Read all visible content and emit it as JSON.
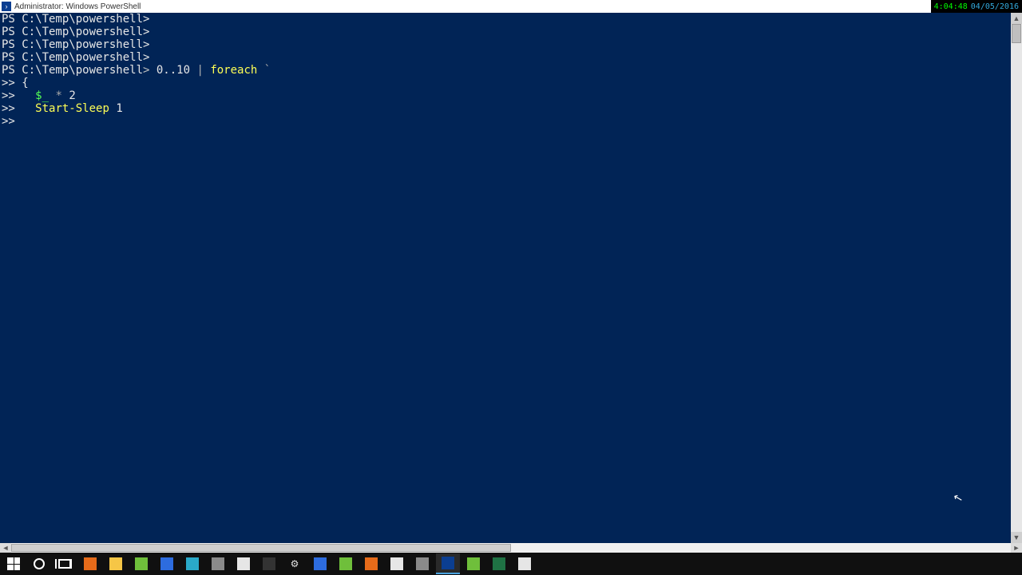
{
  "titlebar": {
    "title": "Administrator: Windows PowerShell"
  },
  "clock": {
    "time": "4:04:48",
    "date": "04/05/2016"
  },
  "console": {
    "prompt_prefix": "PS ",
    "path": "C:\\Temp\\powershell",
    "prompt_suffix": ">",
    "empty_lines": 4,
    "command_line": {
      "caret": ">",
      "range": "0..10",
      "pipe": "|",
      "keyword": "foreach",
      "backtick": "`"
    },
    "continuation": ">>",
    "cont_lines": {
      "l1": "{",
      "l2_var": "$_",
      "l2_op": "*",
      "l2_num": "2",
      "l3_cmd": "Start-Sleep",
      "l3_arg": "1",
      "l4": ""
    }
  },
  "taskbar": {
    "items": [
      {
        "name": "start",
        "active": false,
        "icon": "win"
      },
      {
        "name": "cortana-search",
        "active": false,
        "icon": "circle"
      },
      {
        "name": "task-view",
        "active": false,
        "icon": "taskview"
      },
      {
        "name": "firefox",
        "active": false,
        "icon": "orange"
      },
      {
        "name": "file-explorer",
        "active": false,
        "icon": "folder"
      },
      {
        "name": "notepad-plus",
        "active": false,
        "icon": "green"
      },
      {
        "name": "outlook",
        "active": false,
        "icon": "blue"
      },
      {
        "name": "skype",
        "active": false,
        "icon": "teal"
      },
      {
        "name": "app-cube",
        "active": false,
        "icon": "grey"
      },
      {
        "name": "app-installer",
        "active": false,
        "icon": "white"
      },
      {
        "name": "cmd-prompt",
        "active": false,
        "icon": "dark"
      },
      {
        "name": "settings",
        "active": false,
        "icon": "gear"
      },
      {
        "name": "mail",
        "active": false,
        "icon": "blue"
      },
      {
        "name": "mobaxterm",
        "active": false,
        "icon": "green"
      },
      {
        "name": "app-orange",
        "active": false,
        "icon": "orange"
      },
      {
        "name": "paint",
        "active": false,
        "icon": "white"
      },
      {
        "name": "app-pen",
        "active": false,
        "icon": "grey"
      },
      {
        "name": "powershell",
        "active": true,
        "icon": "ps"
      },
      {
        "name": "app-diff",
        "active": false,
        "icon": "green"
      },
      {
        "name": "excel",
        "active": false,
        "icon": "excel"
      },
      {
        "name": "app-editor",
        "active": false,
        "icon": "white"
      }
    ]
  }
}
